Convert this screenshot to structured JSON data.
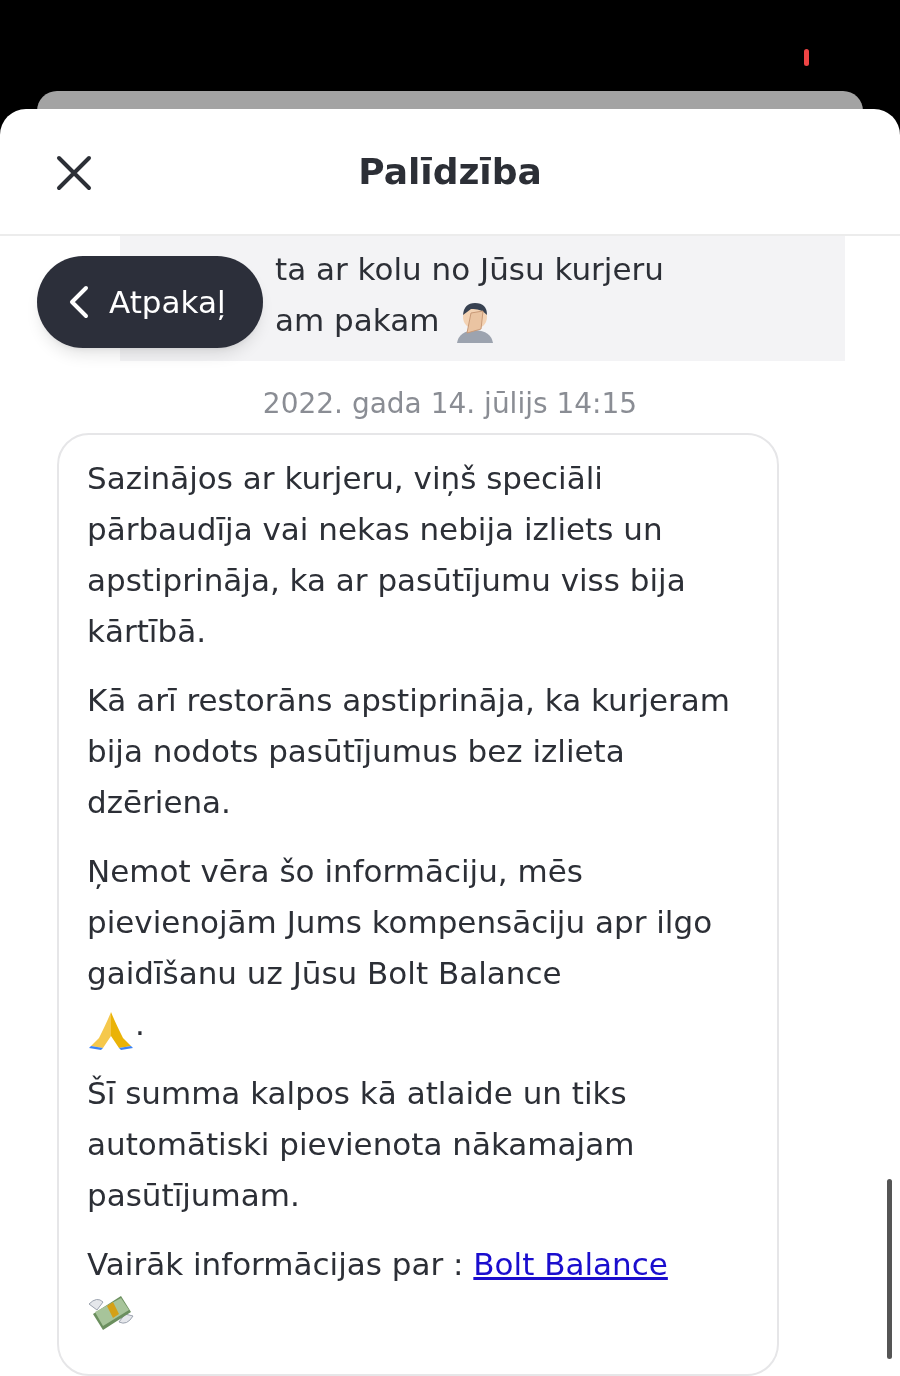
{
  "header": {
    "title": "Palīdzība"
  },
  "back_button": {
    "label": "Atpakaļ"
  },
  "previous_message": {
    "lines": [
      "ta ar kolu no Jūsu kurjeru",
      "am pakam"
    ]
  },
  "timestamp": "2022. gada 14. jūlijs 14:15",
  "message": {
    "paragraphs": [
      {
        "kind": "text",
        "text": "Sazinājos ar kurjeru, viņš speciāli pārbaudīja vai nekas nebija izliets un apstiprināja, ka ar pasūtījumu viss bija kārtībā."
      },
      {
        "kind": "text",
        "text": "Kā arī restorāns apstiprināja, ka kurjeram bija nodots pasūtījumus bez izlieta dzēriena."
      },
      {
        "kind": "emoji",
        "text": "Ņemot vēra šo informāciju, mēs pievienojām Jums kompensāciju apr ilgo gaidīšanu uz Jūsu Bolt Balance",
        "suffix": "."
      },
      {
        "kind": "text",
        "text": "Šī summa kalpos kā atlaide un tiks automātiski pievienota nākamajam pasūtījumam."
      },
      {
        "kind": "link",
        "text": "Vairāk informācijas par :",
        "link": "Bolt Balance"
      }
    ]
  }
}
